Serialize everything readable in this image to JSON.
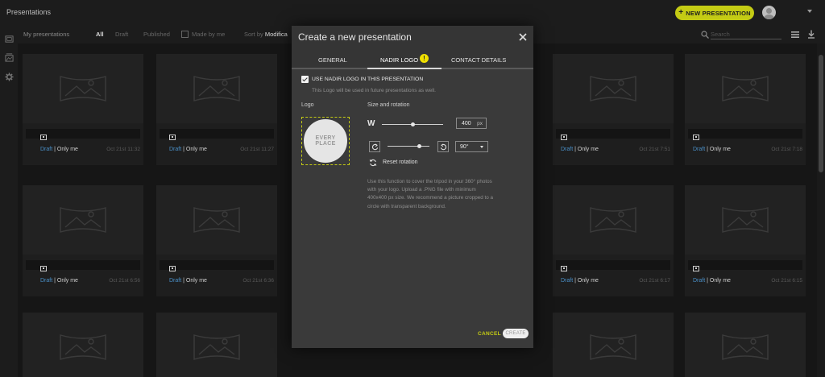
{
  "app": {
    "title": "Presentations",
    "new_button_label": "NEW PRESENTATION",
    "accent_color": "#c4cb14"
  },
  "rail": {
    "icons": [
      "presentations-icon",
      "media-library-icon",
      "settings-gear-icon"
    ]
  },
  "filterbar": {
    "title": "My presentations",
    "filters": [
      "All",
      "Draft",
      "Published"
    ],
    "active_filter": "All",
    "made_by_me_label": "Made by me",
    "sort_label": "Sort by",
    "sort_value": "Modifica",
    "search_placeholder": "Search"
  },
  "cards": [
    {
      "meta_status": "Draft",
      "meta_owner": " | Only me",
      "date": "Oct 21st 11:32"
    },
    {
      "meta_status": "Draft",
      "meta_owner": " | Only me",
      "date": "Oct 21st 11:27"
    },
    {
      "meta_status": "Draft",
      "meta_owner": " | Only me",
      "date": "Oct 21st 7:51"
    },
    {
      "meta_status": "Draft",
      "meta_owner": " | Only me",
      "date": "Oct 21st 7:18"
    },
    {
      "meta_status": "Draft",
      "meta_owner": " | Only me",
      "date": "Oct 21st 6:56"
    },
    {
      "meta_status": "Draft",
      "meta_owner": " | Only me",
      "date": "Oct 21st 6:36"
    },
    {
      "meta_status": "Draft",
      "meta_owner": " | Only me",
      "date": "Oct 21st 6:17"
    },
    {
      "meta_status": "Draft",
      "meta_owner": " | Only me",
      "date": "Oct 21st 6:15"
    }
  ],
  "modal": {
    "title": "Create a new presentation",
    "tabs": [
      "GENERAL",
      "NADIR LOGO",
      "CONTACT DETAILS"
    ],
    "active_tab": "NADIR LOGO",
    "warning_badge": "!",
    "use_logo_label": "USE NADIR LOGO IN THIS PRESENTATION",
    "use_logo_checked": true,
    "use_logo_note": "This Logo will be used in future presentations as well.",
    "logo_label": "Logo",
    "logo_text_line1": "EVERY",
    "logo_text_line2": "PLACE",
    "size_label": "Size and rotation",
    "width_letter": "W",
    "width_value": "400",
    "width_unit": "px",
    "width_slider_fraction": 0.5,
    "rotation_value": "90°",
    "rotation_slider_fraction": 0.75,
    "reset_label": "Reset rotation",
    "help_text": "Use this function to cover the tripod in your 360° photos with your logo. Upload a .PNG file with minimum 400x400 px size. We recommend a picture cropped to a circle with transparent background.",
    "cancel_label": "CANCEL",
    "create_label": "CREATE"
  }
}
